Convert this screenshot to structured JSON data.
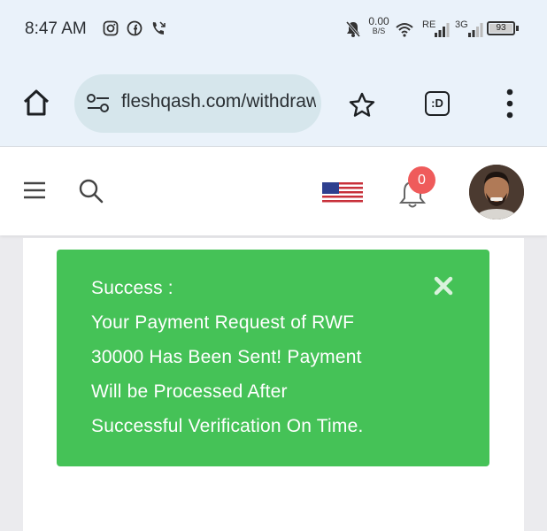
{
  "status_bar": {
    "time": "8:47 AM",
    "net_speed_value": "0.00",
    "net_speed_unit": "B/S",
    "sim1_label": "RE",
    "sim2_label": "3G",
    "battery": "93",
    "icons": [
      "instagram-icon",
      "facebook-icon",
      "missed-call-icon",
      "mute-bell-icon",
      "wifi-icon",
      "signal-icon",
      "battery-icon"
    ]
  },
  "browser": {
    "url": "fleshqash.com/withdraw",
    "tab_button_label": ":D",
    "icons": [
      "home-icon",
      "site-settings-icon",
      "bookmark-star-icon",
      "tab-switcher-icon",
      "more-menu-icon"
    ]
  },
  "site_header": {
    "notification_count": "0",
    "icons": [
      "hamburger-menu-icon",
      "search-icon",
      "us-flag-icon",
      "notification-bell-icon",
      "avatar"
    ]
  },
  "alert": {
    "title": "Success :",
    "lines": [
      "Your Payment Request of RWF",
      "30000 Has Been Sent! Payment",
      "Will be Processed After",
      "Successful Verification On Time."
    ],
    "color": "#45c257"
  }
}
